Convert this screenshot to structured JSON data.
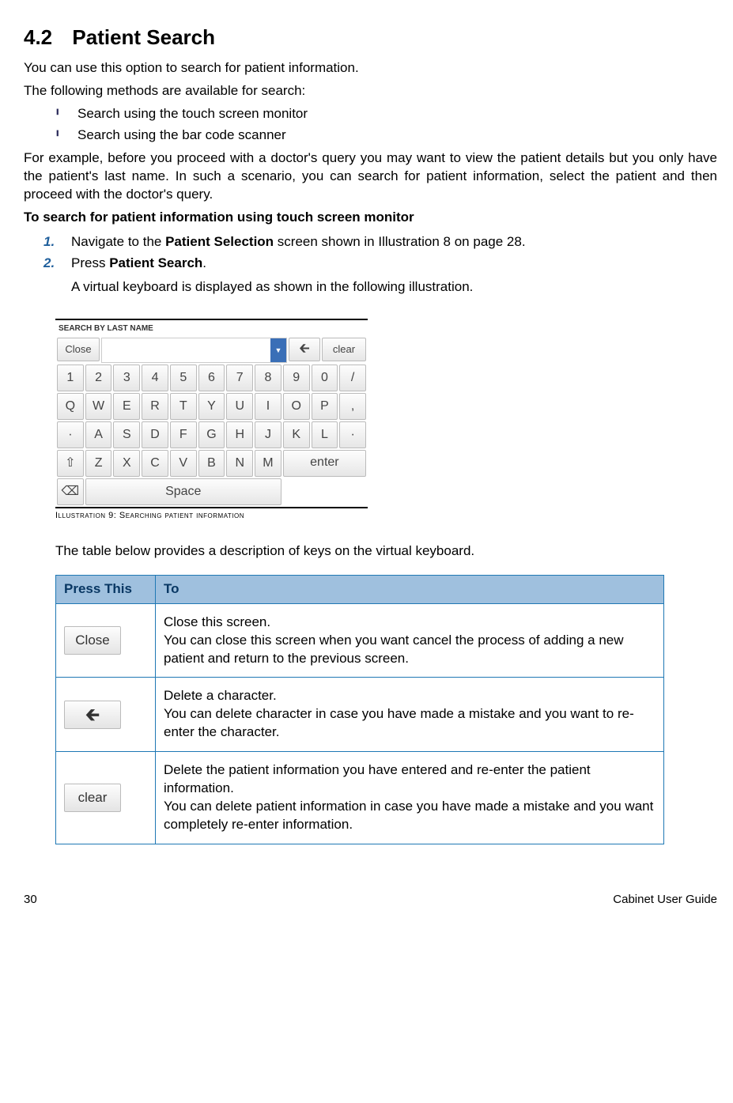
{
  "heading": {
    "num": "4.2",
    "title": "Patient Search"
  },
  "p1": "You can use this option to search for patient information.",
  "p2": "The following methods are available for search:",
  "bullets": [
    "Search using the touch screen monitor",
    "Search using the bar code scanner"
  ],
  "p3": "For example, before you proceed with a doctor's query you may want to view the patient details but you only have the patient's last name. In such a scenario, you can search for patient information, select the patient and then proceed with the doctor's query.",
  "subhead": "To search  for patient information using touch screen monitor",
  "steps": {
    "s1_a": "Navigate to the ",
    "s1_b": "Patient Selection",
    "s1_c": " screen shown in Illustration 8 on page 28.",
    "s2_a": "Press ",
    "s2_b": "Patient Search",
    "s2_c": ".",
    "note": "A virtual keyboard is displayed as shown in the following illustration."
  },
  "keyboard": {
    "header": "SEARCH BY LAST NAME",
    "close": "Close",
    "dropicon": "▼",
    "back": "🡰",
    "clear": "clear",
    "row1": [
      "1",
      "2",
      "3",
      "4",
      "5",
      "6",
      "7",
      "8",
      "9",
      "0",
      "/"
    ],
    "row2": [
      "Q",
      "W",
      "E",
      "R",
      "T",
      "Y",
      "U",
      "I",
      "O",
      "P",
      ","
    ],
    "row3": [
      "·",
      "A",
      "S",
      "D",
      "F",
      "G",
      "H",
      "J",
      "K",
      "L",
      "·"
    ],
    "row4": [
      "⇧",
      "Z",
      "X",
      "C",
      "V",
      "B",
      "N",
      "M"
    ],
    "enter": "enter",
    "row5_lead": "⌫",
    "space": "Space"
  },
  "illus_caption": "Illustration 9: Searching patient information",
  "table_intro": "The table below provides a description of keys on the virtual keyboard.",
  "table": {
    "h1": "Press This",
    "h2": "To",
    "r1_key": "Close",
    "r1_l1": "Close this screen.",
    "r1_l2": "You can close this screen when you want cancel the process of adding a new patient and return to the previous screen.",
    "r2_key": "🡰",
    "r2_l1": "Delete a character.",
    "r2_l2": "You can delete character in case you have made a mistake and you want to re-enter the character.",
    "r3_key": "clear",
    "r3_l1": "Delete the patient information you have entered and re-enter the patient information.",
    "r3_l2": "You can delete patient information in case you have made a mistake and you want completely re-enter information."
  },
  "footer": {
    "page": "30",
    "guide": "Cabinet User Guide"
  }
}
